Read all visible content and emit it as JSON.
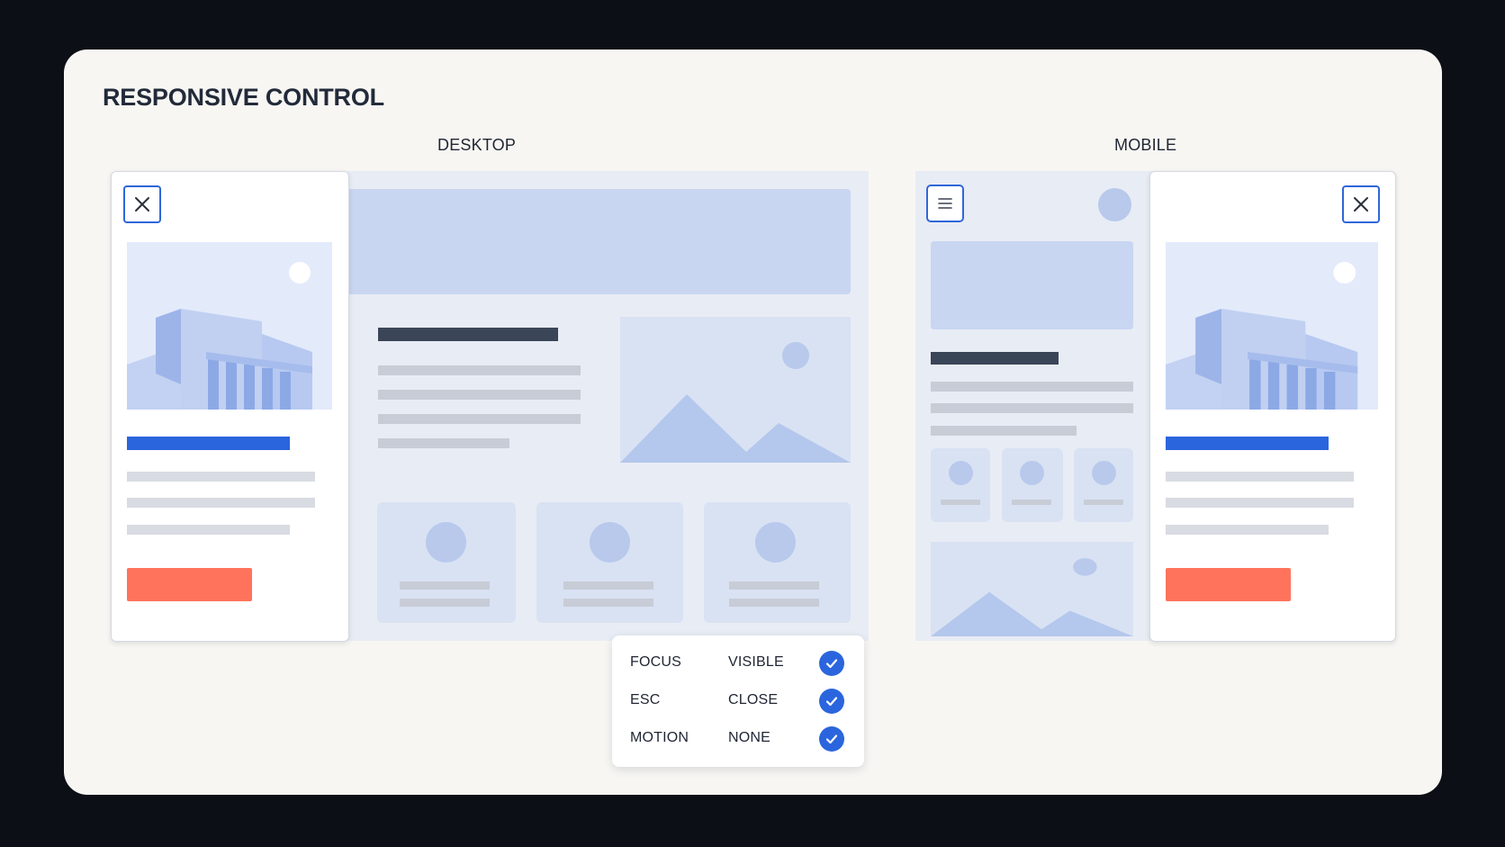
{
  "title": "RESPONSIVE CONTROL",
  "views": {
    "desktop_label": "DESKTOP",
    "mobile_label": "MOBILE"
  },
  "icons": {
    "close": "close-icon",
    "menu": "menu-icon",
    "check": "check-icon",
    "image": "image-icon",
    "building": "building-illustration"
  },
  "settings": [
    {
      "key": "FOCUS",
      "value": "VISIBLE",
      "checked": true
    },
    {
      "key": "ESC",
      "value": "CLOSE",
      "checked": true
    },
    {
      "key": "MOTION",
      "value": "NONE",
      "checked": true
    }
  ],
  "colors": {
    "accent": "#2b65de",
    "cta": "#ff735c",
    "page_background": "#f7f6f3",
    "frame_background": "#0c0f16"
  }
}
